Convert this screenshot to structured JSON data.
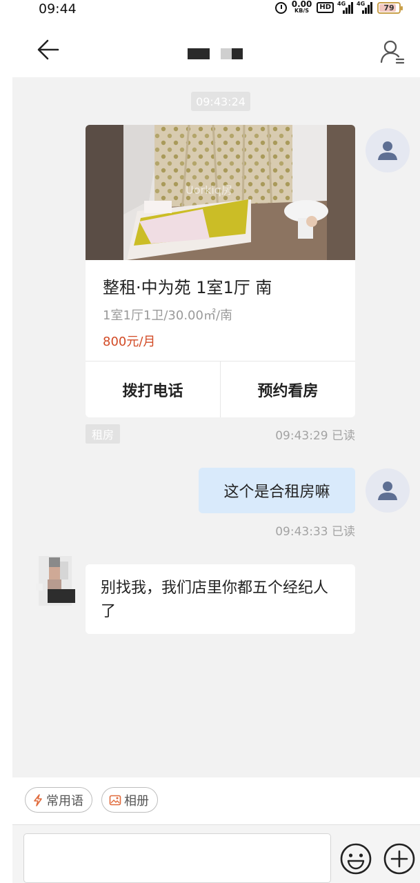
{
  "status_bar": {
    "time": "09:44",
    "net_speed_value": "0.00",
    "net_speed_unit": "KB/S",
    "hd_badge": "HD",
    "signal1_label": "4G",
    "signal2_label": "4G",
    "battery_level": "79",
    "icons": [
      "alarm-icon",
      "hd-icon",
      "signal-icon",
      "signal-icon",
      "battery-icon"
    ]
  },
  "header": {
    "back_icon": "arrow-left-icon",
    "profile_icon": "user-list-icon"
  },
  "chat": {
    "timestamp_chip": "09:43:24",
    "listing_card": {
      "title": "整租·中为苑 1室1厅 南",
      "subtitle": "1室1厅1卫/30.00㎡/南",
      "price": "800元/月",
      "price_color": "#d24a25",
      "watermark": "Uorkiq房",
      "actions": [
        "拨打电话",
        "预约看房"
      ]
    },
    "card_tag": "租房",
    "card_meta": "09:43:29 已读",
    "outgoing_message": "这个是合租房嘛",
    "outgoing_meta": "09:43:33 已读",
    "incoming_message": "别找我，我们店里你都五个经纪人了",
    "user_bubble_color": "#d9eafb"
  },
  "quick_bar": {
    "phrases_label": "常用语",
    "phrases_icon": "lightning-icon",
    "album_label": "相册",
    "album_icon": "image-icon"
  },
  "input_bar": {
    "placeholder": "",
    "emoji_icon": "smiley-icon",
    "plus_icon": "plus-circle-icon"
  }
}
